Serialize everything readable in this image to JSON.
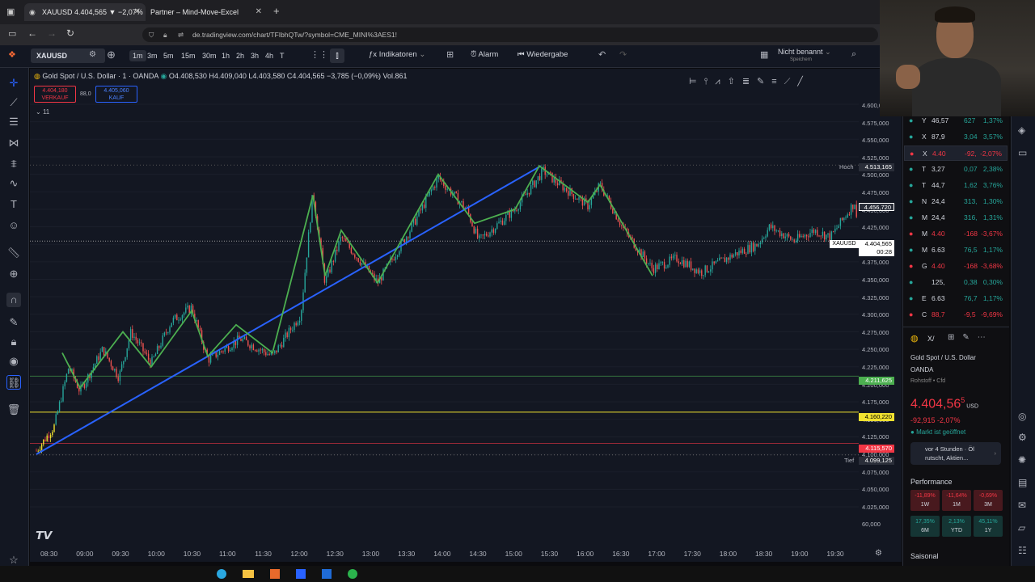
{
  "browser": {
    "tabs": [
      {
        "label": "XAUUSD 4.404,565 ▼ −2,07% N"
      },
      {
        "label": "Partner – Mind-Move-Excel"
      }
    ],
    "url": "de.tradingview.com/chart/TFIbhQTw/?symbol=CME_MINI%3AES1!"
  },
  "toolbar": {
    "symbol": "XAUUSD",
    "timeframes": [
      "1m",
      "3m",
      "5m",
      "15m",
      "30m",
      "1h",
      "2h",
      "3h",
      "4h",
      "T"
    ],
    "indicators": "Indikatoren",
    "alarm": "Alarm",
    "replay": "Wiedergabe",
    "layout_name": "Nicht benannt",
    "layout_sub": "Speichern"
  },
  "legend": {
    "name": "Gold Spot / U.S. Dollar · 1 · OANDA",
    "ohlc": "O4.408,530 H4.409,040 L4.403,580 C4.404,565 −3,785 (−0,09%) Vol.861",
    "sell_price": "4.404,180",
    "sell_label": "VERKAUF",
    "spread": "88,0",
    "buy_price": "4.405,060",
    "buy_label": "KAUF",
    "layer": "11"
  },
  "y_axis": [
    "4.600,000",
    "4.575,000",
    "4.550,000",
    "4.525,000",
    "4.500,000",
    "4.475,000",
    "4.450,000",
    "4.425,000",
    "4.400,000",
    "4.375,000",
    "4.350,000",
    "4.325,000",
    "4.300,000",
    "4.275,000",
    "4.250,000",
    "4.225,000",
    "4.200,000",
    "4.175,000",
    "4.150,000",
    "4.125,000",
    "4.100,000",
    "4.075,000",
    "4.050,000",
    "4.025,000",
    "60,000"
  ],
  "x_axis": [
    "08:30",
    "09:00",
    "09:30",
    "10:00",
    "10:30",
    "11:00",
    "11:30",
    "12:00",
    "12:30",
    "13:00",
    "13:30",
    "14:00",
    "14:30",
    "15:00",
    "15:30",
    "16:00",
    "16:30",
    "17:00",
    "17:30",
    "18:00",
    "18:30",
    "19:00",
    "19:30"
  ],
  "price_tags": {
    "hoch_label": "Hoch",
    "hoch": "4.513,165",
    "p1": "4.456,720",
    "cur_label": "XAUUSD",
    "cur": "4.404,565",
    "countdown": "00:28",
    "green": "4.211,625",
    "yellow": "4.160,220",
    "red": "4.115,570",
    "tief_label": "Tief",
    "tief": "4.099,125"
  },
  "colors": {
    "up": "#26a69a",
    "down": "#ef5350",
    "zigzag": "#4caf50",
    "trend": "#2962ff",
    "bg": "#131722"
  },
  "watchlist": [
    {
      "sym": "Y",
      "last": "46,57",
      "chg": "627",
      "pct": "1,37%",
      "up": true
    },
    {
      "sym": "X",
      "last": "87,9",
      "chg": "3,04",
      "pct": "3,57%",
      "up": true
    },
    {
      "sym": "X",
      "last": "4.40",
      "chg": "-92,",
      "pct": "-2,07%",
      "up": false
    },
    {
      "sym": "T",
      "last": "3,27",
      "chg": "0,07",
      "pct": "2,38%",
      "up": true
    },
    {
      "sym": "T",
      "last": "44,7",
      "chg": "1,62",
      "pct": "3,76%",
      "up": true
    },
    {
      "sym": "N",
      "last": "24,4",
      "chg": "313,",
      "pct": "1,30%",
      "up": true
    },
    {
      "sym": "M",
      "last": "24,4",
      "chg": "316,",
      "pct": "1,31%",
      "up": true
    },
    {
      "sym": "M",
      "last": "4.40",
      "chg": "-168",
      "pct": "-3,67%",
      "up": false
    },
    {
      "sym": "M",
      "last": "6.63",
      "chg": "76,5",
      "pct": "1,17%",
      "up": true
    },
    {
      "sym": "G",
      "last": "4.40",
      "chg": "-168",
      "pct": "-3,68%",
      "up": false
    },
    {
      "sym": "",
      "last": "125,",
      "chg": "0,38",
      "pct": "0,30%",
      "up": true
    },
    {
      "sym": "E",
      "last": "6.63",
      "chg": "76,7",
      "pct": "1,17%",
      "up": true
    },
    {
      "sym": "C",
      "last": "88,7",
      "chg": "-9,5",
      "pct": "-9,69%",
      "up": false
    }
  ],
  "details": {
    "short": "X/",
    "name": "Gold Spot / U.S. Dollar",
    "exchange": "OANDA",
    "category": "Rohstoff • Cfd",
    "price": "4.404,56",
    "price_sup": "5",
    "currency": "USD",
    "change": "-92,915 -2,07%",
    "market": "Markt ist geöffnet",
    "news_time": "vor 4 Stunden · Öl",
    "news_text": "rutscht, Aktien...",
    "performance_title": "Performance",
    "performance": [
      {
        "v": "-11,89%",
        "p": "1W",
        "up": false
      },
      {
        "v": "-11,64%",
        "p": "1M",
        "up": false
      },
      {
        "v": "-0,69%",
        "p": "3M",
        "up": false
      },
      {
        "v": "17,35%",
        "p": "6M",
        "up": true
      },
      {
        "v": "2,13%",
        "p": "YTD",
        "up": true
      },
      {
        "v": "45,11%",
        "p": "1Y",
        "up": true
      }
    ],
    "seasonal": "Saisonal"
  }
}
